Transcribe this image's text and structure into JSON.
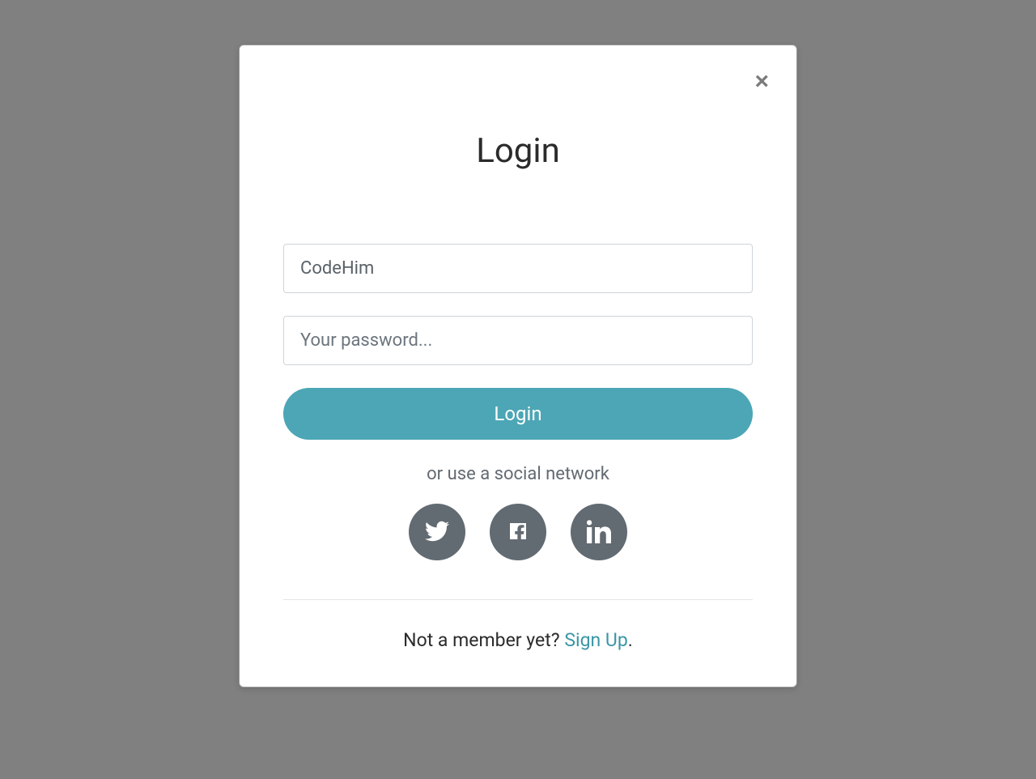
{
  "modal": {
    "title": "Login",
    "close_icon": "×"
  },
  "form": {
    "username_value": "CodeHim",
    "password_placeholder": "Your password...",
    "login_button": "Login",
    "social_prompt": "or use a social network"
  },
  "social": {
    "twitter": "twitter",
    "facebook": "facebook",
    "linkedin": "linkedin"
  },
  "footer": {
    "prompt": "Not a member yet? ",
    "link": "Sign Up",
    "suffix": "."
  },
  "colors": {
    "background": "#808080",
    "accent": "#4ca6b5",
    "social_bg": "#626a72",
    "link": "#3a96a7"
  }
}
